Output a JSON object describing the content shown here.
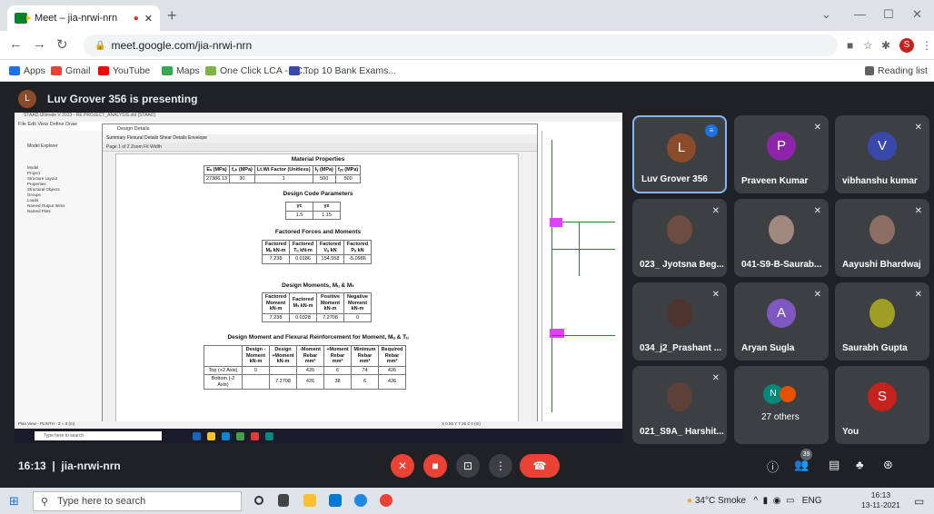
{
  "browser": {
    "tab_title": "Meet – jia-nrwi-nrn",
    "url": "meet.google.com/jia-nrwi-nrn",
    "reading_list": "Reading list",
    "profile_letter": "S",
    "bookmarks": [
      {
        "label": "Apps",
        "color": "#1a73e8"
      },
      {
        "label": "Gmail",
        "color": "#ea4335"
      },
      {
        "label": "YouTube",
        "color": "#ff0000"
      },
      {
        "label": "Maps",
        "color": "#34a853"
      },
      {
        "label": "One Click LCA - LC...",
        "color": "#7cb342"
      },
      {
        "label": "Top 10 Bank Exams...",
        "color": "#3949ab"
      }
    ]
  },
  "presenter": {
    "initial": "L",
    "text": "Luv Grover 356 is presenting"
  },
  "screen": {
    "staad_title": "STAAD.Ultimate V 2023 - RE PROJECT_ANALYSIS.std [STAAD]",
    "staad_menu": "File  Edit  View  Define  Draw",
    "model_explorer": "Model Explorer",
    "tree": [
      "Model",
      "Project",
      "Structure Layout",
      "Properties",
      "Structural Objects",
      "Groups",
      "Loads",
      "Named Output Items",
      "Named Plots"
    ],
    "dialog_title": "Design Details",
    "dialog_tabs": "Summary   Flexural Details   Shear Details   Envelope",
    "dialog_toolbar": "Page  1 of 2   Zoom  Fit Width",
    "status_left": "Plan View - PLINTH - Z = 0 (m)",
    "status_right": "X 0.55  Y 7.25  Z 0 (m)",
    "task_search": "Type here to search",
    "section1": {
      "heading": "Material Properties",
      "headers": [
        "Eₛ (MPa)",
        "f꜀ₖ (MPa)",
        "Lt.Wt Factor (Unitless)",
        "fᵧ (MPa)",
        "fᵧᵥ (MPa)"
      ],
      "row": [
        "27386.13",
        "30",
        "1",
        "500",
        "500"
      ]
    },
    "section2": {
      "heading": "Design Code Parameters",
      "headers": [
        "γc",
        "γs"
      ],
      "row": [
        "1.5",
        "1.15"
      ]
    },
    "section3": {
      "heading": "Factored Forces and Moments",
      "headers": [
        "Factored Mᵤ kN-m",
        "Factored Tᵤ kN-m",
        "Factored Vᵤ kN",
        "Factored Pᵤ kN"
      ],
      "row": [
        "7.238",
        "0.0186",
        "154.558",
        "-5.0986"
      ]
    },
    "section4": {
      "heading": "Design Moments, Mᵤ & Mₜ",
      "headers": [
        "Factored Moment kN-m",
        "Factored Mₜ kN-m",
        "Positive Moment kN-m",
        "Negative Moment kN-m"
      ],
      "row": [
        "7.238",
        "0.0328",
        "7.2708",
        "0"
      ]
    },
    "section5": {
      "heading": "Design Moment and Flexural Reinforcement for Moment, Mᵤ & Tᵤ",
      "headers": [
        "",
        "Design -Moment kN-m",
        "Design +Moment kN-m",
        "-Moment Rebar mm²",
        "+Moment Rebar mm²",
        "Minimum Rebar mm²",
        "Required Rebar mm²"
      ],
      "rows": [
        [
          "Top (+2 Axis)",
          "0",
          "",
          "426",
          "6",
          "74",
          "426"
        ],
        [
          "Bottom (-2 Axis)",
          "",
          "7.2708",
          "426",
          "38",
          "6",
          "426"
        ]
      ]
    }
  },
  "tiles": [
    {
      "name": "Luv Grover 356",
      "initial": "L",
      "color": "#8a4b2a",
      "active": true
    },
    {
      "name": "Praveen Kumar",
      "initial": "P",
      "color": "#8e24aa"
    },
    {
      "name": "vibhanshu kumar",
      "initial": "V",
      "color": "#3949ab"
    },
    {
      "name": "023_ Jyotsna Beg...",
      "initial": "",
      "color": "#6d4c41"
    },
    {
      "name": "041-S9-B-Saurab...",
      "initial": "",
      "color": "#a1887f"
    },
    {
      "name": "Aayushi Bhardwaj",
      "initial": "",
      "color": "#8d6e63"
    },
    {
      "name": "034_j2_Prashant ...",
      "initial": "",
      "color": "#4e342e"
    },
    {
      "name": "Aryan Sugla",
      "initial": "A",
      "color": "#7e57c2"
    },
    {
      "name": "Saurabh Gupta",
      "initial": "",
      "color": "#9e9d24"
    },
    {
      "name": "021_S9A_ Harshit...",
      "initial": "",
      "color": "#5d4037"
    },
    {
      "name": "27 others",
      "initial": "N",
      "color": "#00897b"
    },
    {
      "name": "You",
      "initial": "S",
      "color": "#c5221f"
    }
  ],
  "bottom": {
    "time": "16:13",
    "code": "jia-nrwi-nrn",
    "participants": "39"
  },
  "windows": {
    "search": "Type here to search",
    "weather": "34°C Smoke",
    "lang": "ENG",
    "time": "16:13",
    "date": "13-11-2021"
  }
}
